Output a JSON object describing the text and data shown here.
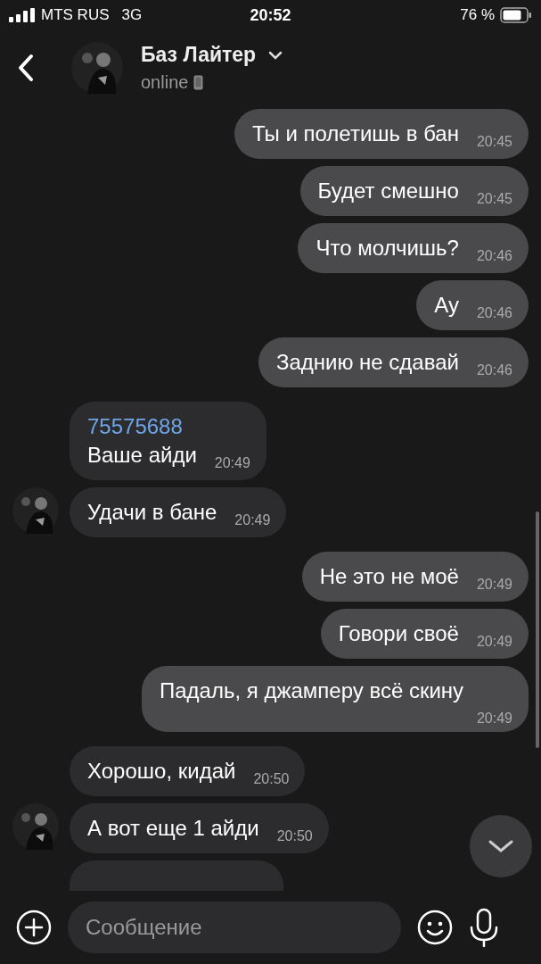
{
  "status_bar": {
    "carrier": "MTS RUS",
    "network": "3G",
    "time": "20:52",
    "battery": "76 %"
  },
  "header": {
    "name": "Баз Лайтер",
    "status": "online"
  },
  "messages": [
    {
      "kind": "out",
      "text": "Ты и полетишь в бан",
      "time": "20:45"
    },
    {
      "kind": "out",
      "text": "Будет смешно",
      "time": "20:45"
    },
    {
      "kind": "out",
      "text": "Что молчишь?",
      "time": "20:46"
    },
    {
      "kind": "out",
      "text": "Ау",
      "time": "20:46"
    },
    {
      "kind": "out",
      "text": "Заднию не сдавай",
      "time": "20:46"
    },
    {
      "kind": "in",
      "link": "75575688",
      "text": "Ваше айди",
      "time": "20:49",
      "avatar": false
    },
    {
      "kind": "in",
      "text": "Удачи в бане",
      "time": "20:49",
      "avatar": true
    },
    {
      "kind": "out",
      "text": "Не это не моё",
      "time": "20:49"
    },
    {
      "kind": "out",
      "text": "Говори своё",
      "time": "20:49"
    },
    {
      "kind": "out",
      "text": "Падаль, я джамперу всё скину",
      "time": "20:49"
    },
    {
      "kind": "in",
      "text": "Хорошо, кидай",
      "time": "20:50",
      "avatar": false
    },
    {
      "kind": "in",
      "text": "А вот еще 1 айди",
      "time": "20:50",
      "avatar": true
    },
    {
      "kind": "partial"
    }
  ],
  "composer": {
    "placeholder": "Сообщение"
  }
}
